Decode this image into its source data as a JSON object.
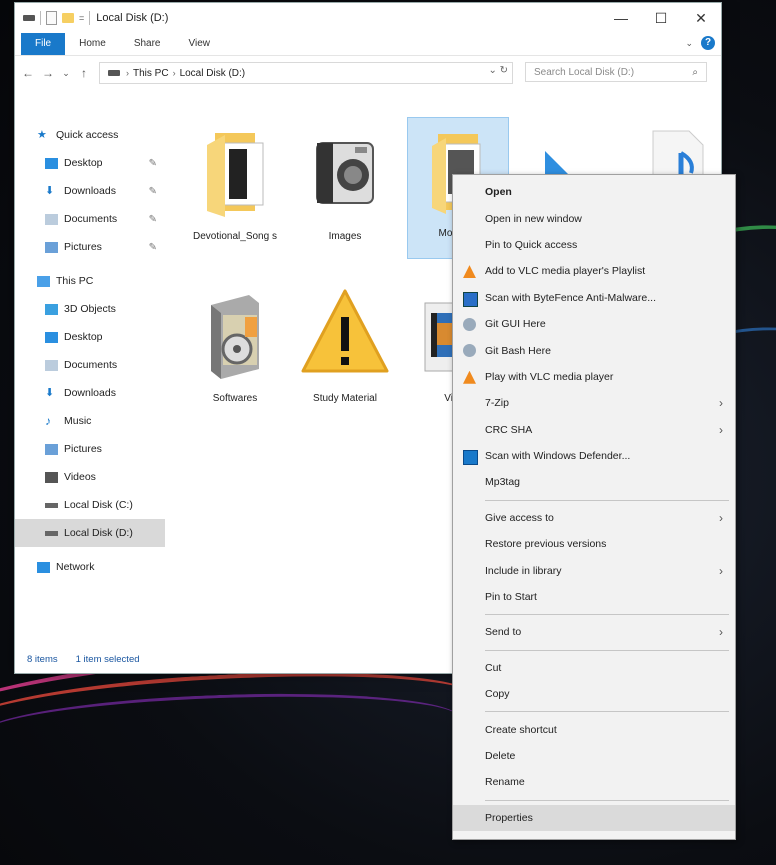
{
  "window": {
    "title": "Local Disk (D:)",
    "controls": {
      "minimize": "—",
      "maximize": "☐",
      "close": "✕"
    }
  },
  "ribbon": {
    "tabs": [
      "File",
      "Home",
      "Share",
      "View"
    ],
    "expand_glyph": "⌄",
    "help_glyph": "?"
  },
  "address": {
    "back": "←",
    "forward": "→",
    "history": "⌄",
    "up": "↑",
    "crumbs": [
      "This PC",
      "Local Disk (D:)"
    ],
    "crumb_sep": "›",
    "controls": "⌄  ↻",
    "search_placeholder": "Search Local Disk (D:)",
    "search_icon": "⌕"
  },
  "sidebar": {
    "pin_glyph": "📌",
    "items": [
      {
        "label": "Quick access",
        "icon": "star-icon",
        "pinned": false
      },
      {
        "label": "Desktop",
        "icon": "desktop-icon",
        "pinned": true
      },
      {
        "label": "Downloads",
        "icon": "download-icon",
        "pinned": true
      },
      {
        "label": "Documents",
        "icon": "documents-icon",
        "pinned": true
      },
      {
        "label": "Pictures",
        "icon": "pictures-icon",
        "pinned": true
      },
      {
        "label": "This PC",
        "icon": "computer-icon",
        "pinned": false
      },
      {
        "label": "3D Objects",
        "icon": "cube-icon",
        "pinned": false
      },
      {
        "label": "Desktop",
        "icon": "desktop-icon",
        "pinned": false
      },
      {
        "label": "Documents",
        "icon": "documents-icon",
        "pinned": false
      },
      {
        "label": "Downloads",
        "icon": "download-icon",
        "pinned": false
      },
      {
        "label": "Music",
        "icon": "music-icon",
        "pinned": false
      },
      {
        "label": "Pictures",
        "icon": "pictures-icon",
        "pinned": false
      },
      {
        "label": "Videos",
        "icon": "video-icon",
        "pinned": false
      },
      {
        "label": "Local Disk (C:)",
        "icon": "drive-icon",
        "pinned": false
      },
      {
        "label": "Local Disk (D:)",
        "icon": "drive-icon",
        "pinned": false
      },
      {
        "label": "Network",
        "icon": "network-icon",
        "pinned": false
      }
    ],
    "selected": "Local Disk (D:)"
  },
  "content": {
    "items": [
      {
        "label": "Devotional_Song s",
        "icon": "folder-icon"
      },
      {
        "label": "Images",
        "icon": "camera-icon"
      },
      {
        "label": "Movie_S",
        "icon": "folder-icon"
      },
      {
        "label": "",
        "icon": "triangle-icon"
      },
      {
        "label": "",
        "icon": "music-file-icon"
      },
      {
        "label": "Softwares",
        "icon": "software-box-icon"
      },
      {
        "label": "Study Material",
        "icon": "warning-icon"
      },
      {
        "label": "Video",
        "icon": "film-icon"
      }
    ],
    "selected": "Movie_S"
  },
  "status": {
    "count": "8 items",
    "selection": "1 item selected"
  },
  "context_menu": {
    "submenu_glyph": "›",
    "items": [
      {
        "label": "Open",
        "bold": true
      },
      {
        "label": "Open in new window"
      },
      {
        "label": "Pin to Quick access"
      },
      {
        "label": "Add to VLC media player's Playlist",
        "icon": "vlc-icon"
      },
      {
        "label": "Scan with ByteFence Anti-Malware...",
        "icon": "bytefence-icon"
      },
      {
        "label": "Git GUI Here",
        "icon": "git-icon"
      },
      {
        "label": "Git Bash Here",
        "icon": "git-icon"
      },
      {
        "label": "Play with VLC media player",
        "icon": "vlc-icon"
      },
      {
        "label": "7-Zip",
        "submenu": true
      },
      {
        "label": "CRC SHA",
        "submenu": true
      },
      {
        "label": "Scan with Windows Defender...",
        "icon": "defender-icon"
      },
      {
        "label": "Mp3tag"
      },
      {
        "separator": true
      },
      {
        "label": "Give access to",
        "submenu": true
      },
      {
        "label": "Restore previous versions"
      },
      {
        "label": "Include in library",
        "submenu": true
      },
      {
        "label": "Pin to Start"
      },
      {
        "separator": true
      },
      {
        "label": "Send to",
        "submenu": true
      },
      {
        "separator": true
      },
      {
        "label": "Cut"
      },
      {
        "label": "Copy"
      },
      {
        "separator": true
      },
      {
        "label": "Create shortcut"
      },
      {
        "label": "Delete"
      },
      {
        "label": "Rename"
      },
      {
        "separator": true
      },
      {
        "label": "Properties",
        "hover": true
      }
    ]
  },
  "colors": {
    "accent": "#1979ca",
    "selection": "#cce4f7",
    "folder": "#f6cf62"
  }
}
